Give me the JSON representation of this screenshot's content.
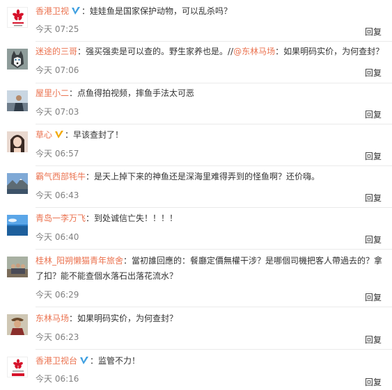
{
  "reply_label": "回复",
  "colors": {
    "username": "#eb7350",
    "verified": "#3e9fe0",
    "verified_gold": "#f2a800"
  },
  "comments": [
    {
      "user": "香港卫视",
      "badge": "verified-blue-icon",
      "sep": "：",
      "text": "娃娃鱼是国家保护动物，可以乱杀吗？",
      "time": "今天 07:25"
    },
    {
      "user": "迷途的三哥",
      "sep": "：",
      "text": "强买强卖是可以查的。野生家养也是。",
      "repost_prefix": "//",
      "mention": "@东林马场",
      "repost_text": "：如果明码实价，为何查封？",
      "time": "今天 07:06"
    },
    {
      "user": "屋里小二",
      "sep": "：",
      "text": "点鱼得拍视频，摔鱼手法太可恶",
      "time": "今天 07:03"
    },
    {
      "user": "草心",
      "badge": "verified-gold-icon",
      "sep": "：",
      "text": "早该查封了！",
      "time": "今天 06:57"
    },
    {
      "user": "霸气西部牦牛",
      "sep": "：",
      "text": "是天上掉下来的神鱼还是深海里难得弄到的怪鱼啊？还价嗨。",
      "time": "今天 06:43"
    },
    {
      "user": "青岛一李万飞",
      "sep": "：",
      "text": "到处诚信亡失！！！！",
      "time": "今天 06:40"
    },
    {
      "user": "桂林_阳朔懒猫青年旅舍",
      "sep": "：",
      "text": "當初誰回應的：餐廳定價無權干涉？是哪個司機把客人帶過去的？拿了扣？能不能查個水落石出落花流水？",
      "time": "今天 06:29"
    },
    {
      "user": "东林马场",
      "sep": "：",
      "text": "如果明码实价，为何查封？",
      "time": "今天 06:23"
    },
    {
      "user": "香港卫视台",
      "badge": "verified-blue-icon",
      "sep": "：",
      "text": "监管不力！",
      "time": "今天 06:16"
    }
  ]
}
